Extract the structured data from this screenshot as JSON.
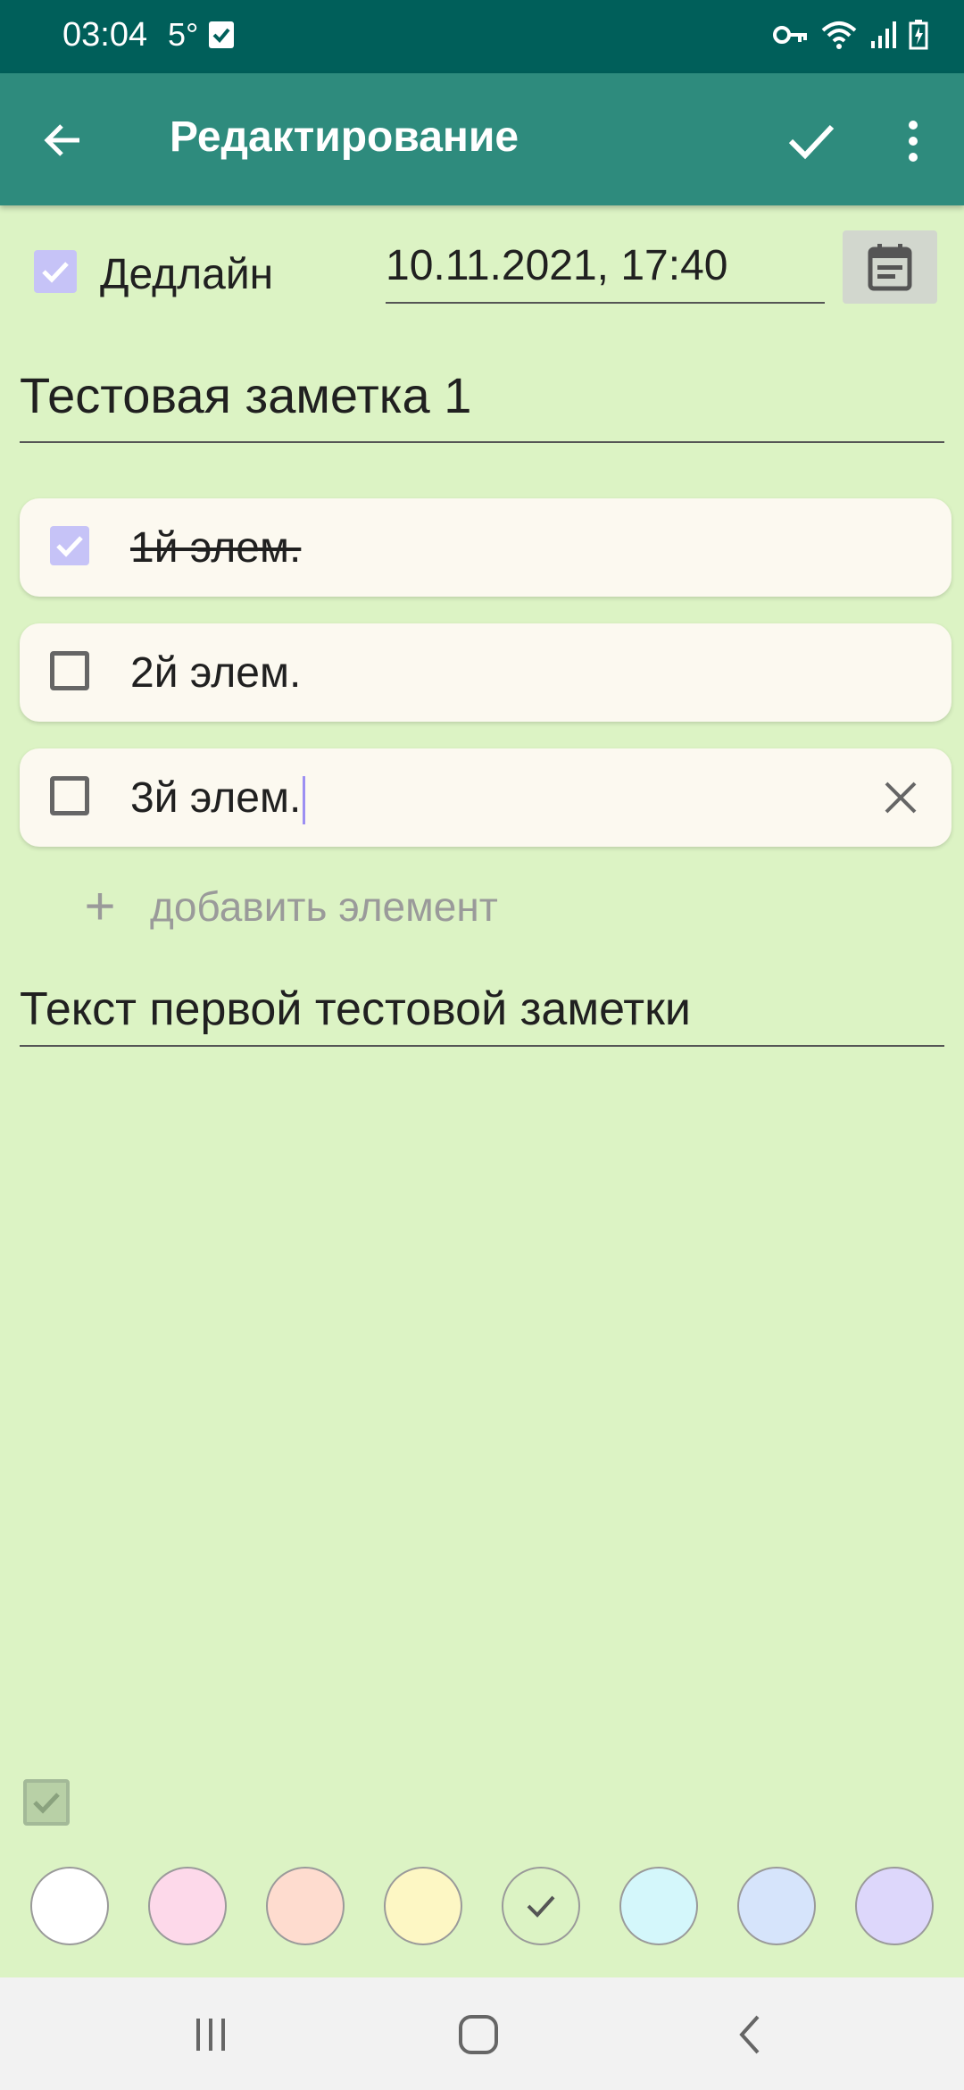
{
  "status_bar": {
    "time": "03:04",
    "temperature": "5°",
    "icons": [
      "check-notification-icon",
      "key-icon",
      "wifi-icon",
      "signal-icon",
      "battery-icon"
    ]
  },
  "app_bar": {
    "title": "Редактирование",
    "background": "#2e8b7d"
  },
  "deadline": {
    "label": "Дедлайн",
    "checked": true,
    "value": "10.11.2021, 17:40"
  },
  "note": {
    "title": "Тестовая заметка 1",
    "body": "Текст первой тестовой заметки"
  },
  "checklist": {
    "items": [
      {
        "text": "1й элем.",
        "checked": true
      },
      {
        "text": "2й элем.",
        "checked": false
      },
      {
        "text": "3й элем.",
        "checked": false
      }
    ],
    "add_label": "добавить элемент"
  },
  "colors": {
    "page_background": "#dcf3c4",
    "accent": "#c6c3f7",
    "swatches": [
      "#ffffff",
      "#fdd9ea",
      "#fedccf",
      "#fdf7c4",
      "#dcf3c4",
      "#d4f7fb",
      "#d6e4fb",
      "#ddd7fb"
    ],
    "selected_swatch_index": 4
  }
}
